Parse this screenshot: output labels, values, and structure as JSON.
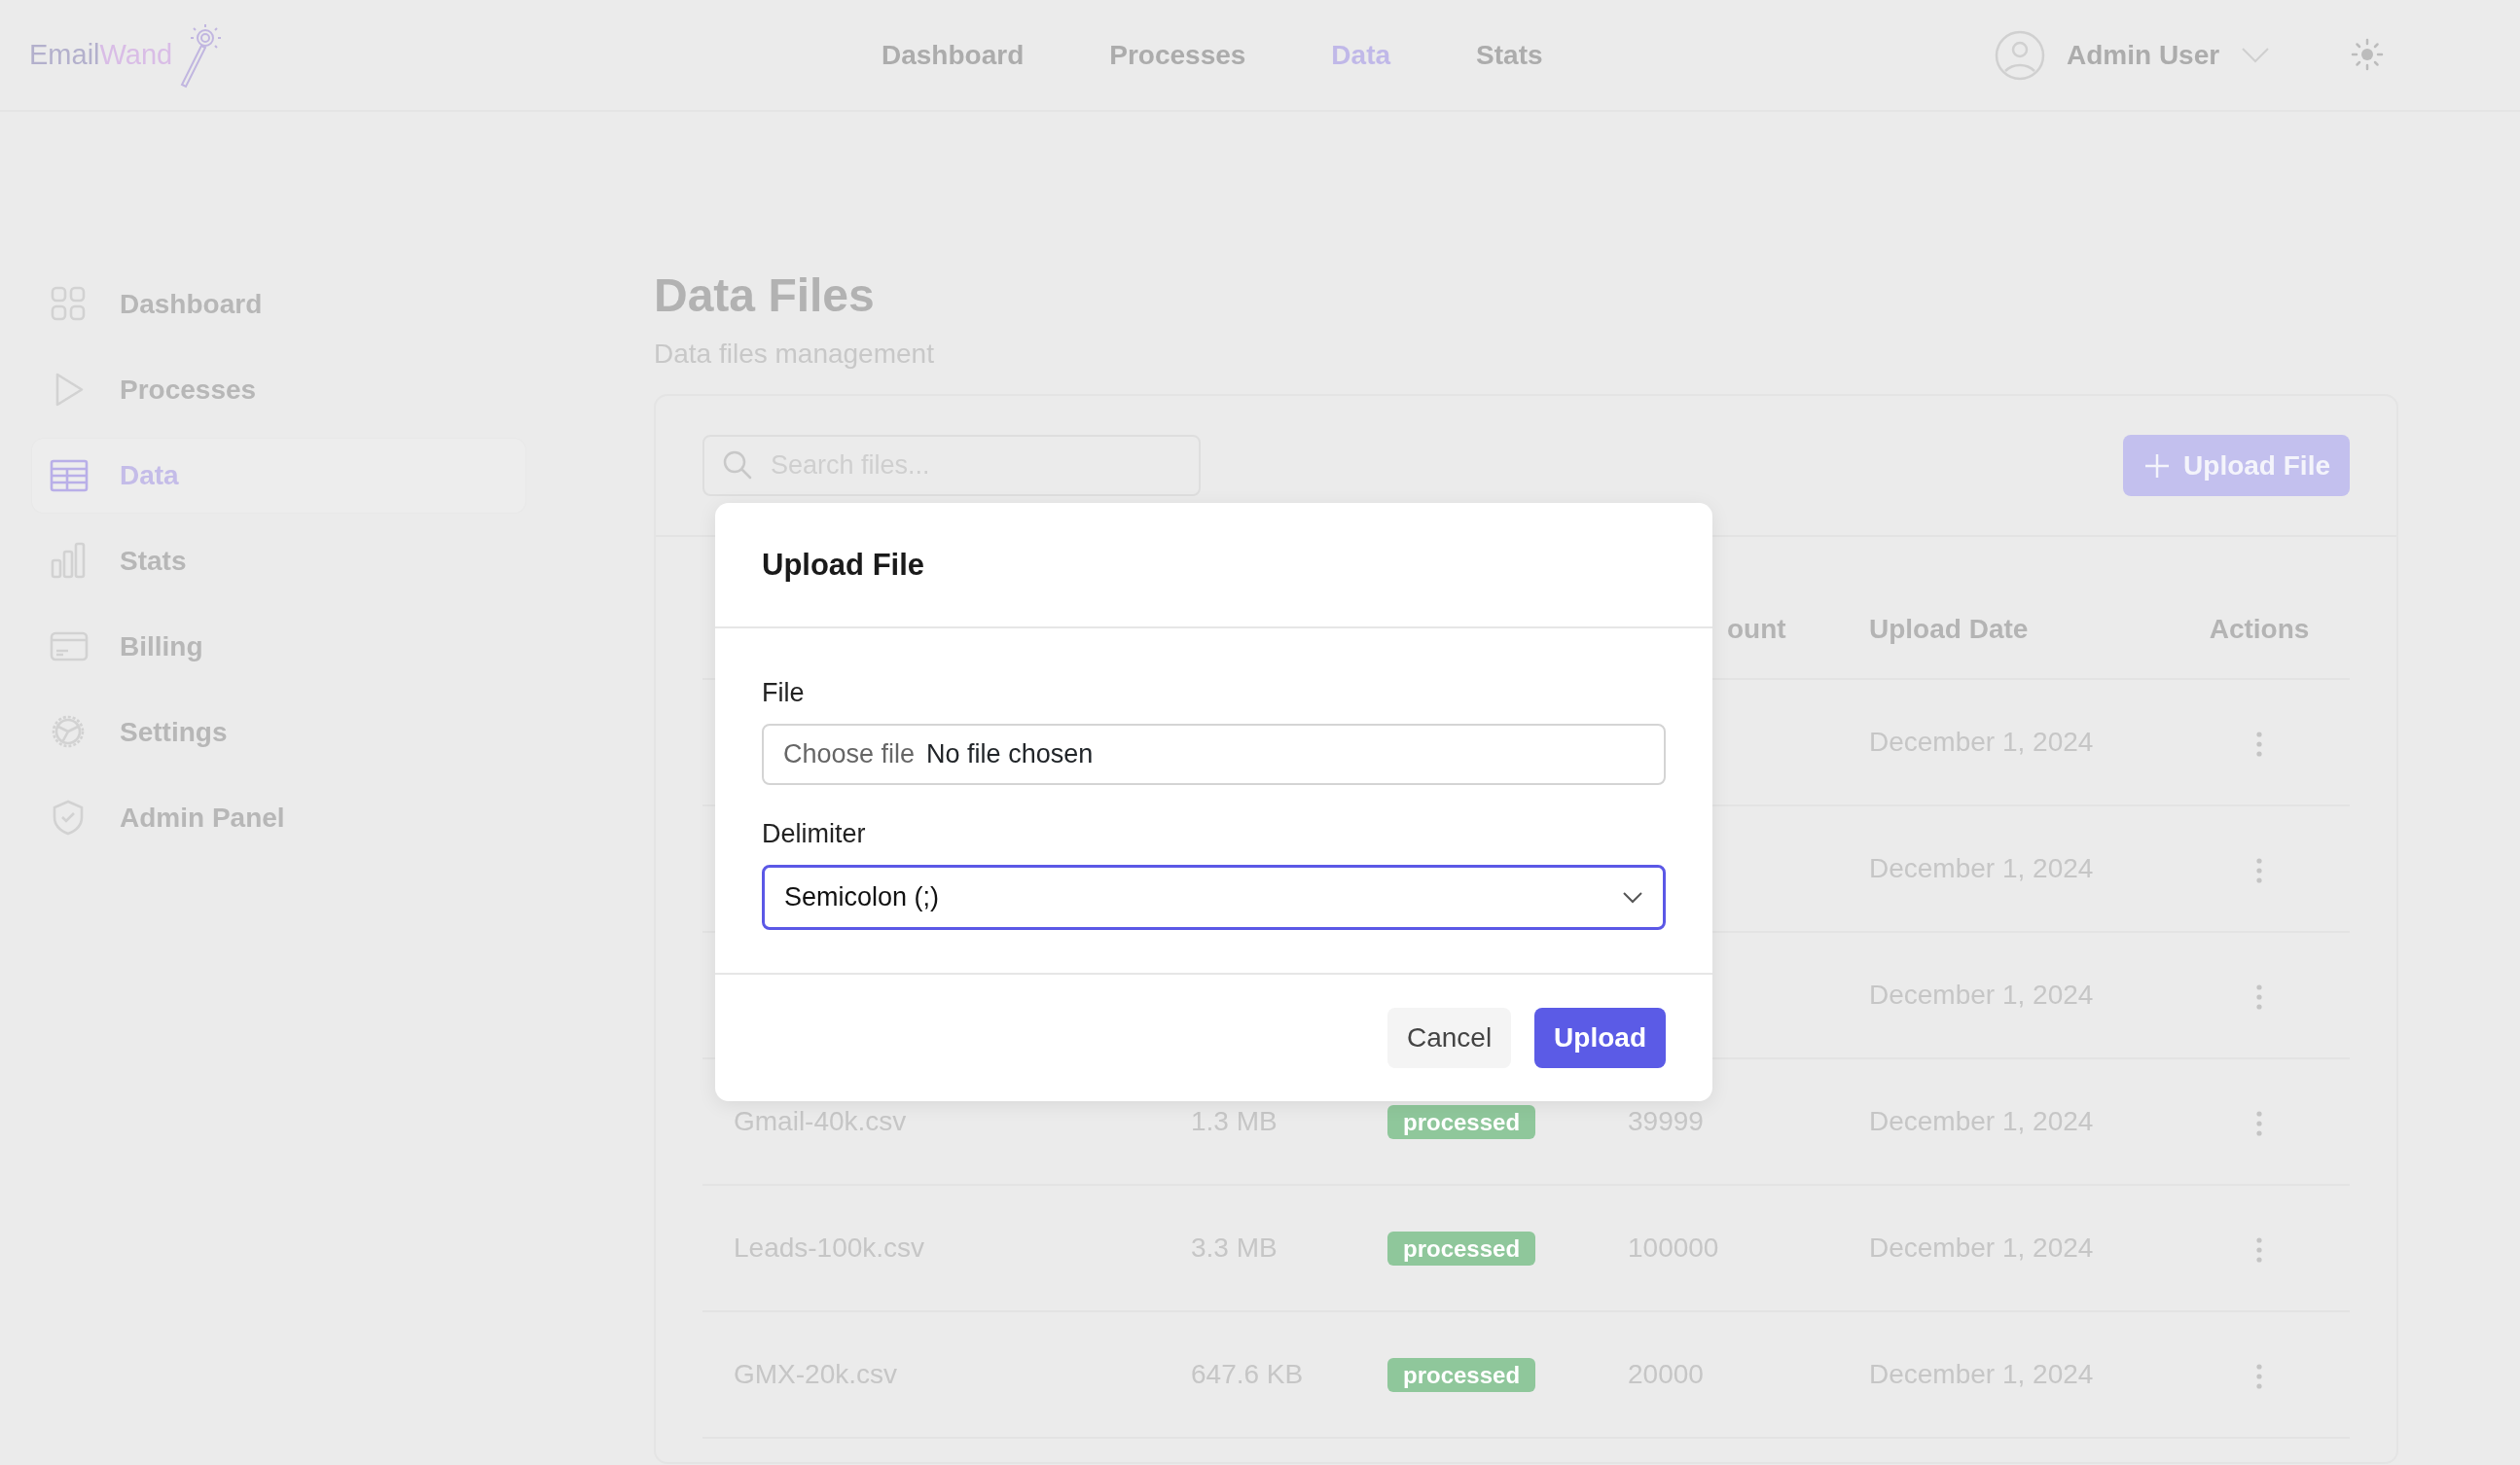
{
  "logo": {
    "part1": "Email",
    "part2": "Wand"
  },
  "nav": [
    {
      "label": "Dashboard",
      "selected": false
    },
    {
      "label": "Processes",
      "selected": false
    },
    {
      "label": "Data",
      "selected": true
    },
    {
      "label": "Stats",
      "selected": false
    }
  ],
  "user": {
    "name": "Admin User"
  },
  "sidebar": {
    "items": [
      {
        "label": "Dashboard",
        "selected": false
      },
      {
        "label": "Processes",
        "selected": false
      },
      {
        "label": "Data",
        "selected": true
      },
      {
        "label": "Stats",
        "selected": false
      },
      {
        "label": "Billing",
        "selected": false
      },
      {
        "label": "Settings",
        "selected": false
      },
      {
        "label": "Admin Panel",
        "selected": false
      }
    ]
  },
  "page": {
    "title": "Data Files",
    "subtitle": "Data files management"
  },
  "toolbar": {
    "search": {
      "placeholder": "Search files..."
    },
    "upload_button": "Upload File"
  },
  "table": {
    "columns": [
      {
        "label": "ount"
      },
      {
        "label": "Upload Date"
      },
      {
        "label": "Actions"
      }
    ],
    "rows": [
      {
        "date": "December 1, 2024"
      },
      {
        "date": "December 1, 2024"
      },
      {
        "date": "December 1, 2024"
      },
      {
        "name": "Gmail-40k.csv",
        "size": "1.3 MB",
        "status": "processed",
        "count": "39999",
        "date": "December 1, 2024"
      },
      {
        "name": "Leads-100k.csv",
        "size": "3.3 MB",
        "status": "processed",
        "count": "100000",
        "date": "December 1, 2024"
      },
      {
        "name": "GMX-20k.csv",
        "size": "647.6 KB",
        "status": "processed",
        "count": "20000",
        "date": "December 1, 2024"
      }
    ]
  },
  "modal": {
    "title": "Upload File",
    "fields": [
      {
        "kind": "file",
        "label": "File",
        "button": "Choose file",
        "value": "No file chosen",
        "focused": false
      },
      {
        "kind": "select",
        "label": "Delimiter",
        "value": "Semicolon (;)",
        "focused": true
      }
    ],
    "buttons": [
      {
        "label": "Cancel",
        "kind": "secondary"
      },
      {
        "label": "Upload",
        "kind": "primary"
      }
    ]
  }
}
